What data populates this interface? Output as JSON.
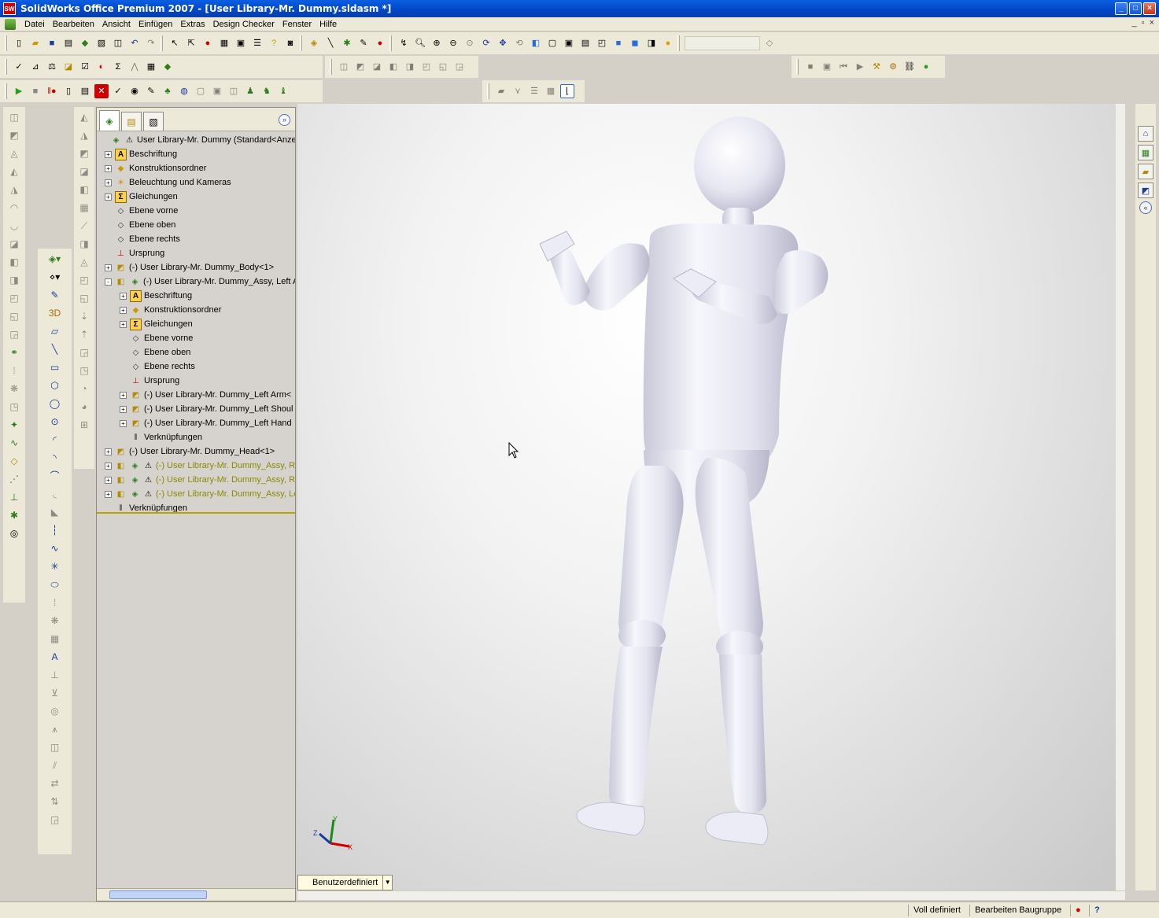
{
  "window": {
    "title": "SolidWorks Office Premium 2007 - [User Library-Mr. Dummy.sldasm *]",
    "app_badge": "SW",
    "buttons": [
      "_",
      "□",
      "×"
    ]
  },
  "menu": {
    "items": [
      "Datei",
      "Bearbeiten",
      "Ansicht",
      "Einfügen",
      "Extras",
      "Design Checker",
      "Fenster",
      "Hilfe"
    ],
    "mdi_buttons": [
      "_",
      "▫",
      "×"
    ]
  },
  "feature_manager": {
    "tree": [
      {
        "label": "User Library-Mr. Dummy  (Standard<Anzeig",
        "level": 0,
        "expander": "",
        "icon": "assembly-icon",
        "warn": true,
        "olive": false
      },
      {
        "label": "Beschriftung",
        "level": 1,
        "expander": "+",
        "icon": "annotation-icon",
        "warn": false,
        "olive": false
      },
      {
        "label": "Konstruktionsordner",
        "level": 1,
        "expander": "+",
        "icon": "design-folder-icon",
        "warn": false,
        "olive": false
      },
      {
        "label": "Beleuchtung und Kameras",
        "level": 1,
        "expander": "+",
        "icon": "lighting-icon",
        "warn": false,
        "olive": false
      },
      {
        "label": "Gleichungen",
        "level": 1,
        "expander": "+",
        "icon": "equation-icon",
        "warn": false,
        "olive": false
      },
      {
        "label": "Ebene vorne",
        "level": 1,
        "expander": "",
        "icon": "plane-icon",
        "warn": false,
        "olive": false
      },
      {
        "label": "Ebene oben",
        "level": 1,
        "expander": "",
        "icon": "plane-icon",
        "warn": false,
        "olive": false
      },
      {
        "label": "Ebene rechts",
        "level": 1,
        "expander": "",
        "icon": "plane-icon",
        "warn": false,
        "olive": false
      },
      {
        "label": "Ursprung",
        "level": 1,
        "expander": "",
        "icon": "origin-icon",
        "warn": false,
        "olive": false
      },
      {
        "label": "(-) User Library-Mr. Dummy_Body<1>",
        "level": 1,
        "expander": "+",
        "icon": "part-icon",
        "warn": false,
        "olive": false
      },
      {
        "label": "(-) User Library-Mr. Dummy_Assy, Left Arm",
        "level": 1,
        "expander": "-",
        "icon": "subassembly-icon",
        "warn": false,
        "olive": false
      },
      {
        "label": "Beschriftung",
        "level": 2,
        "expander": "+",
        "icon": "annotation-icon",
        "warn": false,
        "olive": false
      },
      {
        "label": "Konstruktionsordner",
        "level": 2,
        "expander": "+",
        "icon": "design-folder-icon",
        "warn": false,
        "olive": false
      },
      {
        "label": "Gleichungen",
        "level": 2,
        "expander": "+",
        "icon": "equation-icon",
        "warn": false,
        "olive": false
      },
      {
        "label": "Ebene vorne",
        "level": 2,
        "expander": "",
        "icon": "plane-icon",
        "warn": false,
        "olive": false
      },
      {
        "label": "Ebene oben",
        "level": 2,
        "expander": "",
        "icon": "plane-icon",
        "warn": false,
        "olive": false
      },
      {
        "label": "Ebene rechts",
        "level": 2,
        "expander": "",
        "icon": "plane-icon",
        "warn": false,
        "olive": false
      },
      {
        "label": "Ursprung",
        "level": 2,
        "expander": "",
        "icon": "origin-icon",
        "warn": false,
        "olive": false
      },
      {
        "label": "(-) User Library-Mr. Dummy_Left Arm<",
        "level": 2,
        "expander": "+",
        "icon": "part-icon",
        "warn": false,
        "olive": false
      },
      {
        "label": "(-) User Library-Mr. Dummy_Left Shoul",
        "level": 2,
        "expander": "+",
        "icon": "part-icon",
        "warn": false,
        "olive": false
      },
      {
        "label": "(-) User Library-Mr. Dummy_Left Hand",
        "level": 2,
        "expander": "+",
        "icon": "part-icon",
        "warn": false,
        "olive": false
      },
      {
        "label": "Verknüpfungen",
        "level": 2,
        "expander": "",
        "icon": "mates-icon",
        "warn": false,
        "olive": false
      },
      {
        "label": "(-) User Library-Mr. Dummy_Head<1>",
        "level": 1,
        "expander": "+",
        "icon": "part-icon",
        "warn": false,
        "olive": false
      },
      {
        "label": "(-) User Library-Mr. Dummy_Assy, Righ",
        "level": 1,
        "expander": "+",
        "icon": "subassembly-icon",
        "warn": true,
        "olive": true
      },
      {
        "label": "(-) User Library-Mr. Dummy_Assy, Righ",
        "level": 1,
        "expander": "+",
        "icon": "subassembly-icon",
        "warn": true,
        "olive": true
      },
      {
        "label": "(-) User Library-Mr. Dummy_Assy, Left",
        "level": 1,
        "expander": "+",
        "icon": "subassembly-icon",
        "warn": true,
        "olive": true
      },
      {
        "label": "Verknüpfungen",
        "level": 1,
        "expander": "",
        "icon": "mates-icon",
        "warn": false,
        "olive": false
      }
    ]
  },
  "viewport": {
    "view_mode": "Benutzerdefiniert",
    "triad": {
      "x": "X",
      "y": "Y",
      "z": "Z"
    }
  },
  "status": {
    "definition": "Voll definiert",
    "mode": "Bearbeiten Baugruppe",
    "help": "?"
  },
  "colors": {
    "title_bar": "#0046c8",
    "chrome": "#ece9d8",
    "tree_bg": "#d6d3ce",
    "model": "#e9e9f6",
    "olive_text": "#8a8a00"
  }
}
